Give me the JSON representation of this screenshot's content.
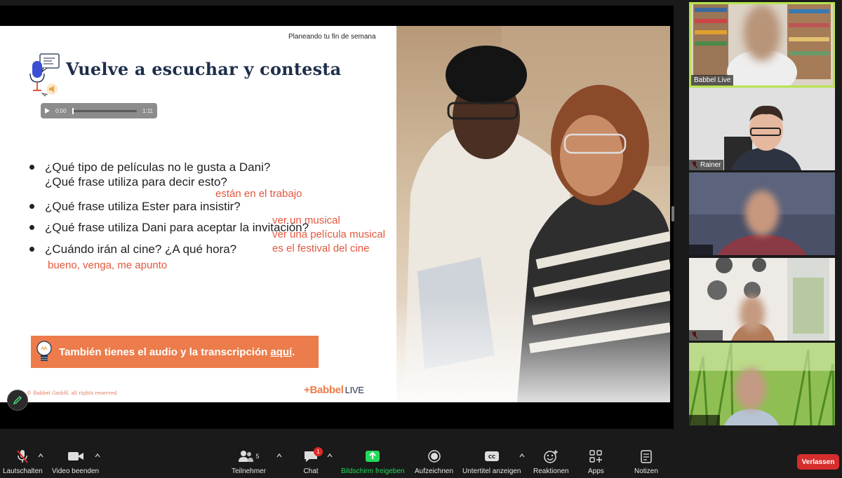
{
  "slide": {
    "subtitle": "Planeando tu fin de semana",
    "title": "Vuelve a escuchar y contesta",
    "audio": {
      "current_time": "0:00",
      "duration": "1:11",
      "progress": 0
    },
    "questions": [
      {
        "lines": [
          "¿Qué tipo de películas no le gusta a Dani?",
          "¿Qué frase utiliza para decir esto?"
        ]
      },
      {
        "lines": [
          "¿Qué frase utiliza Ester para insistir?"
        ]
      },
      {
        "lines": [
          "¿Qué frase utiliza Dani para aceptar la invitación?"
        ]
      },
      {
        "lines": [
          "¿Cuándo irán al cine? ¿A qué hora?"
        ]
      }
    ],
    "annotations": [
      "están en el trabajo",
      "ver un musical",
      "ver una película musical",
      "es el festival del cine",
      "bueno, venga, me apunto"
    ],
    "annotation_color": "#e2573e",
    "banner": {
      "text": "También tienes el audio y la transcripción",
      "link": "aquí",
      "suffix": ".",
      "color": "#ec7c4b"
    },
    "copyright": "© Babbel GmbH, all rights reserved",
    "brand": {
      "name": "+Babbel",
      "suffix": "LIVE"
    },
    "title_color": "#1e2e4a"
  },
  "participants": [
    {
      "name": "Babbel Live",
      "active": true,
      "muted": false
    },
    {
      "name": "Rainer",
      "active": false,
      "muted": true
    },
    {
      "name": "",
      "active": false,
      "muted": false
    },
    {
      "name": "",
      "active": false,
      "muted": true
    },
    {
      "name": "",
      "active": false,
      "muted": false
    }
  ],
  "toolbar": {
    "mute": {
      "label": "Lautschalten",
      "icon": "mic-off-icon"
    },
    "video": {
      "label": "Video beenden",
      "icon": "video-camera-icon"
    },
    "participants": {
      "label": "Teilnehmer",
      "count": "5",
      "icon": "people-icon"
    },
    "chat": {
      "label": "Chat",
      "badge": "1",
      "icon": "chat-bubble-icon"
    },
    "share": {
      "label": "Bildschirm freigeben",
      "icon": "share-screen-icon",
      "color": "#23d959"
    },
    "record": {
      "label": "Aufzeichnen",
      "icon": "record-icon"
    },
    "captions": {
      "label": "Untertitel anzeigen",
      "icon": "cc-icon"
    },
    "reactions": {
      "label": "Reaktionen",
      "icon": "emoji-plus-icon"
    },
    "apps": {
      "label": "Apps",
      "icon": "apps-icon"
    },
    "notes": {
      "label": "Notizen",
      "icon": "notes-icon"
    },
    "leave": {
      "label": "Verlassen",
      "color": "#d62d2d"
    }
  }
}
